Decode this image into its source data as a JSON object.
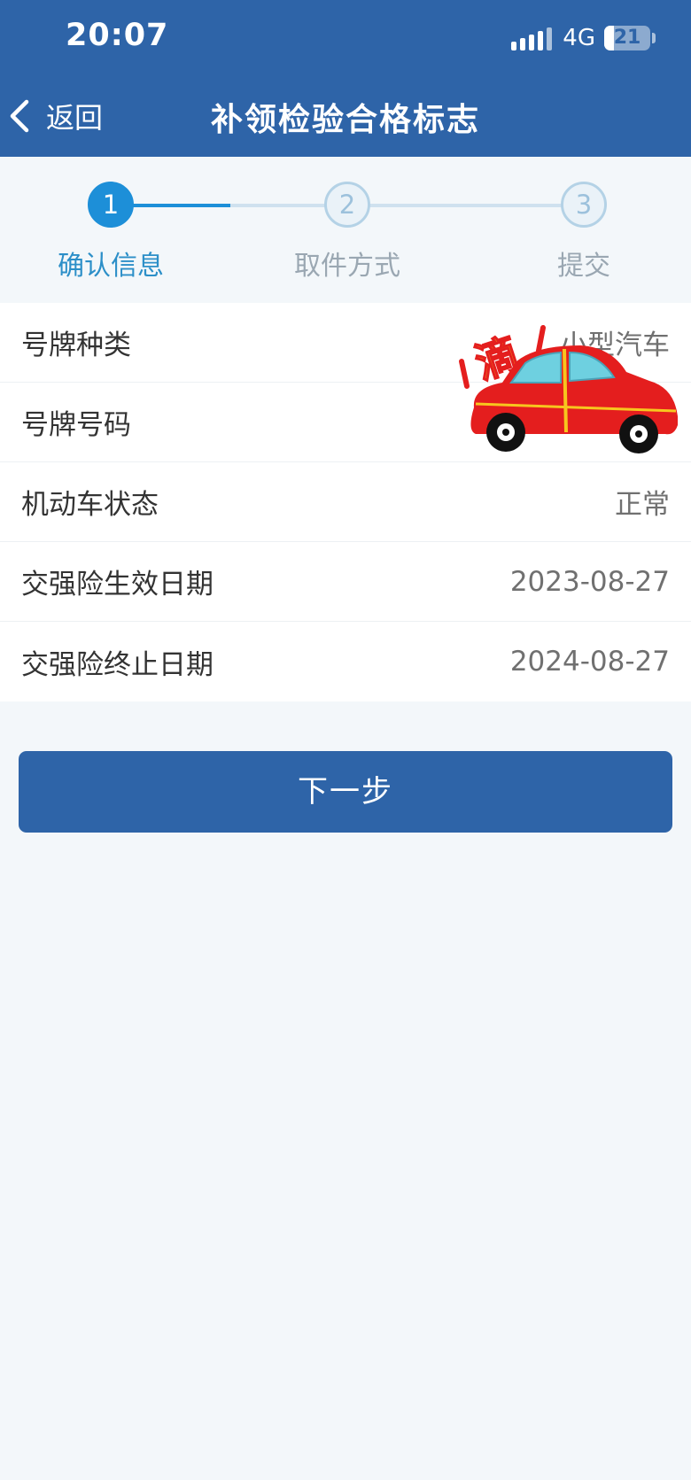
{
  "status_bar": {
    "time": "20:07",
    "network": "4G",
    "battery_level": "21",
    "battery_fraction": 0.21
  },
  "nav": {
    "back_label": "返回",
    "title": "补领检验合格标志"
  },
  "steps": [
    {
      "number": "1",
      "label": "确认信息",
      "state": "active"
    },
    {
      "number": "2",
      "label": "取件方式",
      "state": "inactive"
    },
    {
      "number": "3",
      "label": "提交",
      "state": "inactive"
    }
  ],
  "info_rows": [
    {
      "label": "号牌种类",
      "value": "小型汽车"
    },
    {
      "label": "号牌号码",
      "value": ""
    },
    {
      "label": "机动车状态",
      "value": "正常"
    },
    {
      "label": "交强险生效日期",
      "value": "2023-08-27"
    },
    {
      "label": "交强险终止日期",
      "value": "2024-08-27"
    }
  ],
  "sticker": {
    "icon": "red-car-sticker-icon",
    "text": "滴"
  },
  "next_button_label": "下一步",
  "colors": {
    "primary": "#2e64a8",
    "step_active": "#1d8fd8",
    "background": "#f3f7fa"
  }
}
